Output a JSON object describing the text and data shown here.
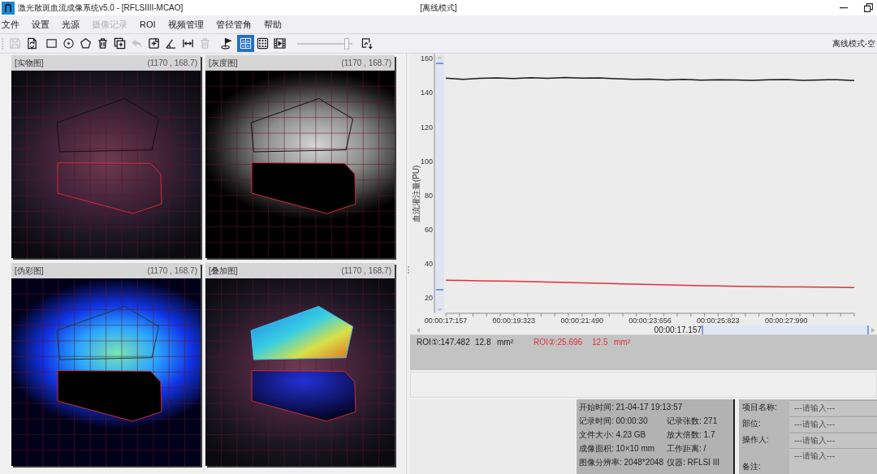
{
  "window": {
    "title": "激光散斑血流成像系统v5.0 - [RFLSIIII-MCAO]",
    "mode_title": "[离线模式]"
  },
  "menu": [
    {
      "label": "文件",
      "disabled": false
    },
    {
      "label": "设置",
      "disabled": false
    },
    {
      "label": "光源",
      "disabled": false
    },
    {
      "label": "摄像记录",
      "disabled": true
    },
    {
      "label": "ROI",
      "disabled": false
    },
    {
      "label": "视频管理",
      "disabled": false
    },
    {
      "label": "管径管角",
      "disabled": false
    },
    {
      "label": "帮助",
      "disabled": false
    }
  ],
  "toolbar": {
    "items": [
      {
        "kind": "save",
        "disabled": true,
        "selected": false
      },
      {
        "kind": "roi-file",
        "disabled": false,
        "selected": false
      },
      {
        "kind": "rectangle",
        "disabled": false,
        "selected": false
      },
      {
        "kind": "circle",
        "disabled": false,
        "selected": false
      },
      {
        "kind": "polygon",
        "disabled": false,
        "selected": false
      },
      {
        "kind": "delete",
        "disabled": false,
        "selected": false
      },
      {
        "kind": "add-window",
        "disabled": false,
        "selected": false
      },
      {
        "kind": "undo",
        "disabled": true,
        "selected": false
      },
      {
        "kind": "add-region",
        "disabled": false,
        "selected": false
      },
      {
        "kind": "angle",
        "disabled": false,
        "selected": false
      },
      {
        "kind": "width",
        "disabled": false,
        "selected": false
      },
      {
        "kind": "delete",
        "disabled": true,
        "selected": false
      },
      {
        "kind": "flag",
        "disabled": false,
        "selected": false
      },
      {
        "kind": "grid-layout",
        "disabled": false,
        "selected": true
      },
      {
        "kind": "dot-layout",
        "disabled": false,
        "selected": false
      },
      {
        "kind": "video",
        "disabled": false,
        "selected": false
      },
      {
        "kind": "slider",
        "level": 0.94
      },
      {
        "kind": "export",
        "disabled": false,
        "selected": false
      }
    ],
    "mode_label": "离线模式-空"
  },
  "image_panels": [
    {
      "title": "[实物图]",
      "coordinates": "(1170 , 168.7)",
      "kind": "photo"
    },
    {
      "title": "[灰度图]",
      "coordinates": "(1170 , 168.7)",
      "kind": "grayscale"
    },
    {
      "title": "[伪彩图]",
      "coordinates": "(1170 , 168.7)",
      "kind": "pseudocolor"
    },
    {
      "title": "[叠加图]",
      "coordinates": "(1170 , 168.7)",
      "kind": "overlay"
    }
  ],
  "chart": {
    "chart_data": {
      "type": "line",
      "ylabel": "血流灌注量(PU)",
      "categories": [
        "00:00:17:157",
        null,
        null,
        null,
        "00:00:19:323",
        null,
        null,
        null,
        "00:00:21:490",
        null,
        null,
        null,
        "00:00:23:656",
        null,
        null,
        null,
        "00:00:25:823",
        null,
        null,
        null,
        "00:00:27:990",
        null,
        null,
        null,
        null
      ],
      "series": [
        {
          "color": "#1a1a1a",
          "values": [
            148.6,
            147.9,
            148.5,
            148.7,
            148.4,
            148.9,
            148.5,
            149.0,
            148.6,
            148.8,
            148.3,
            147.9,
            148.1,
            147.6,
            147.9,
            147.4,
            147.7,
            147.5,
            147.3,
            147.7,
            147.8,
            147.3,
            147.6,
            147.7,
            147.2
          ]
        },
        {
          "color": "#e0303a",
          "values": [
            30.4,
            30.2,
            30.0,
            29.9,
            29.7,
            29.5,
            29.3,
            29.1,
            28.8,
            28.6,
            28.3,
            28.1,
            27.8,
            27.6,
            27.4,
            27.2,
            27.0,
            26.8,
            26.7,
            26.6,
            26.5,
            26.4,
            26.3,
            26.2,
            26.1
          ]
        }
      ],
      "ylim": [
        11,
        163
      ],
      "yticks": [
        20,
        40,
        60,
        80,
        100,
        120,
        140,
        160
      ]
    },
    "range_label": "00:00:17.157"
  },
  "roi_readouts": [
    {
      "value": "ROI①:147.482",
      "area": "12.8",
      "unit": "mm²",
      "color": "#1a1a1a"
    },
    {
      "value": "ROI②:25.696",
      "area": "12.5",
      "unit": "mm²",
      "color": "#e0303a"
    }
  ],
  "recording_info": [
    [
      "开始时间: 21-04-17 19:13:57"
    ],
    [
      "记录时间: 00:00:30",
      "记录张数: 271"
    ],
    [
      "文件大小: 4.23 GB",
      "放大倍数: 1.7"
    ],
    [
      "成像面积: 10×10 mm",
      "工作距离: /"
    ],
    [
      "图像分辨率: 2048*2048",
      "仪器: RFLSI III"
    ]
  ],
  "metadata_form": [
    {
      "label": "项目名称:",
      "placeholder": "---请输入---",
      "kind": "line"
    },
    {
      "label": "部位:",
      "placeholder": "---请输入---",
      "kind": "line"
    },
    {
      "label": "操作人:",
      "placeholder": "---请输入---",
      "kind": "line"
    },
    {
      "label": "备注:",
      "placeholder": "---请输入---",
      "kind": "multiline"
    }
  ]
}
